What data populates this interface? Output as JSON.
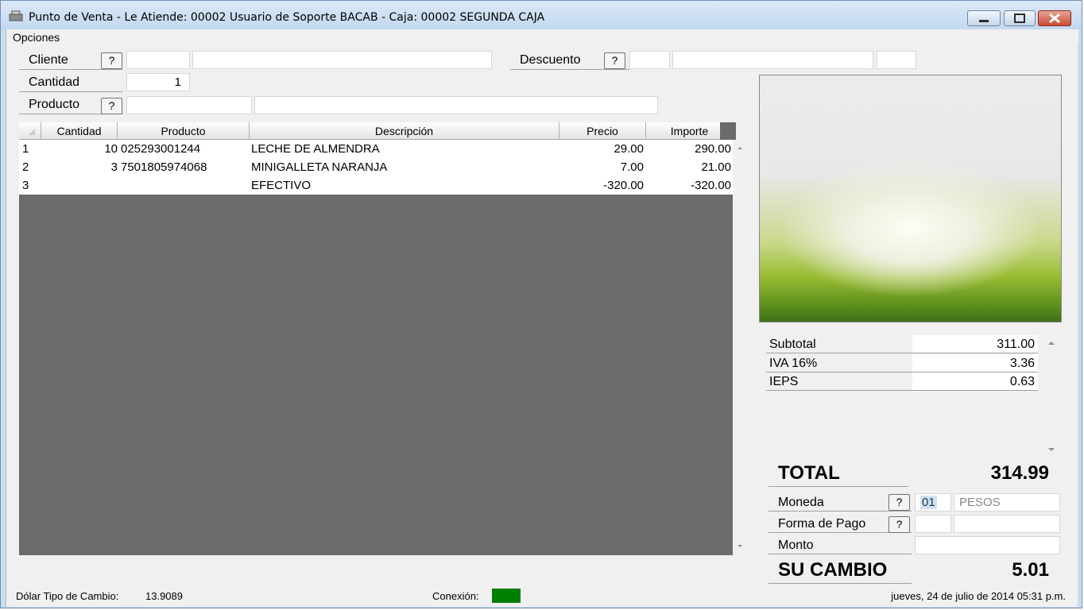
{
  "window": {
    "title": "Punto de Venta - Le Atiende: 00002 Usuario de Soporte BACAB - Caja: 00002 SEGUNDA CAJA"
  },
  "menu": {
    "opciones": "Opciones"
  },
  "form": {
    "cliente_label": "Cliente",
    "cantidad_label": "Cantidad",
    "cantidad_value": "1",
    "producto_label": "Producto",
    "descuento_label": "Descuento",
    "help_label": "?"
  },
  "grid": {
    "columns": [
      "Cantidad",
      "Producto",
      "Descripción",
      "Precio",
      "Importe"
    ],
    "rows": [
      {
        "n": "1",
        "cantidad": "10",
        "producto": "025293001244",
        "descripcion": "LECHE DE ALMENDRA",
        "precio": "29.00",
        "importe": "290.00"
      },
      {
        "n": "2",
        "cantidad": "3",
        "producto": "7501805974068",
        "descripcion": "MINIGALLETA NARANJA",
        "precio": "7.00",
        "importe": "21.00"
      },
      {
        "n": "3",
        "cantidad": "",
        "producto": "",
        "descripcion": "EFECTIVO",
        "precio": "-320.00",
        "importe": "-320.00"
      }
    ]
  },
  "totals": {
    "subtotal_label": "Subtotal",
    "subtotal": "311.00",
    "iva_label": "IVA 16%",
    "iva": "3.36",
    "ieps_label": "IEPS",
    "ieps": "0.63",
    "total_label": "TOTAL",
    "total": "314.99",
    "moneda_label": "Moneda",
    "moneda_code": "01",
    "moneda_name": "PESOS",
    "forma_pago_label": "Forma de Pago",
    "monto_label": "Monto",
    "cambio_label": "SU CAMBIO",
    "cambio": "5.01"
  },
  "status": {
    "dolar_label": "Dólar Tipo de Cambio:",
    "dolar_value": "13.9089",
    "conexion_label": "Conexión:",
    "conexion_color": "#008000",
    "datetime": "jueves, 24 de julio de 2014 05:31 p.m."
  },
  "colors": {
    "grid_bg": "#6b6b6b",
    "moneda_highlight": "#cde2f7"
  }
}
